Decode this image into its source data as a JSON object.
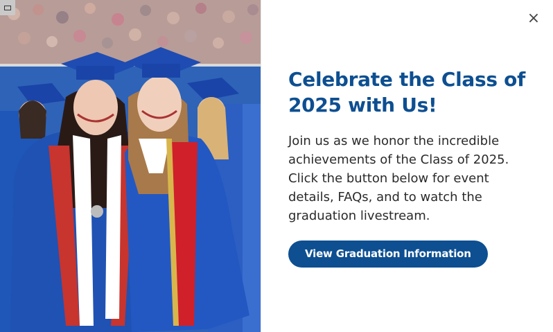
{
  "modal": {
    "close_icon": "close-icon",
    "close_glyph": "×",
    "headline": "Celebrate the Class of 2025 with Us!",
    "body": "Join us as we honor the incredible achievements of the Class of 2025. Click the button below for event details, FAQs, and to watch the graduation livestream.",
    "cta_label": "View Graduation Information",
    "colors": {
      "accent": "#0d4f91",
      "text": "#2a2a2a",
      "gown_blue": "#1f52b3",
      "sash_red": "#d0202a"
    }
  },
  "photo": {
    "description_icon": "graduation-photo",
    "mode_icon": "image-mode-icon"
  }
}
